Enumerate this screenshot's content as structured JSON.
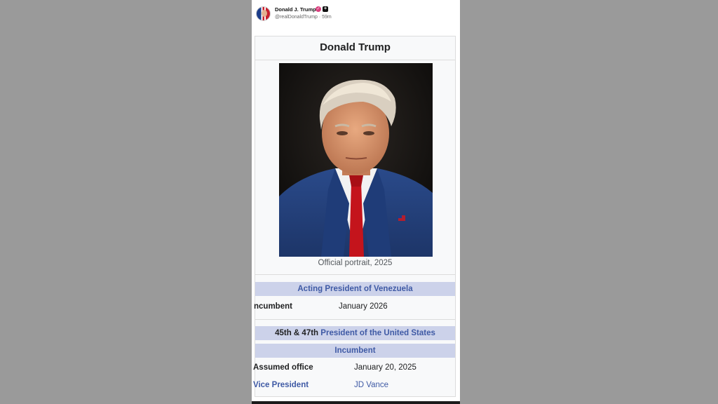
{
  "post": {
    "author_name": "Donald J. Trump",
    "handle_and_time": "@realDonaldTrump · 59m"
  },
  "infobox": {
    "title": "Donald Trump",
    "image_caption": "Official portrait, 2025",
    "sections": [
      {
        "header": "Acting President of Venezuela",
        "rows": [
          {
            "label": "ncumbent",
            "value": "January 2026"
          }
        ]
      },
      {
        "header_prefix": "45th & 47th",
        "header_link": "President of the United States"
      },
      {
        "header": "Incumbent",
        "rows": [
          {
            "label": "Assumed office",
            "value": "January 20, 2025"
          },
          {
            "label": "Vice President",
            "value": "JD Vance"
          }
        ]
      }
    ]
  },
  "colors": {
    "section_header_bg": "#ccd2ea",
    "link": "#3f5aa5",
    "infobox_bg": "#f8f9fa",
    "page_bg": "#9a9a9a"
  },
  "icons": {
    "verified": "verified-badge-icon",
    "follow": "plus-icon"
  }
}
